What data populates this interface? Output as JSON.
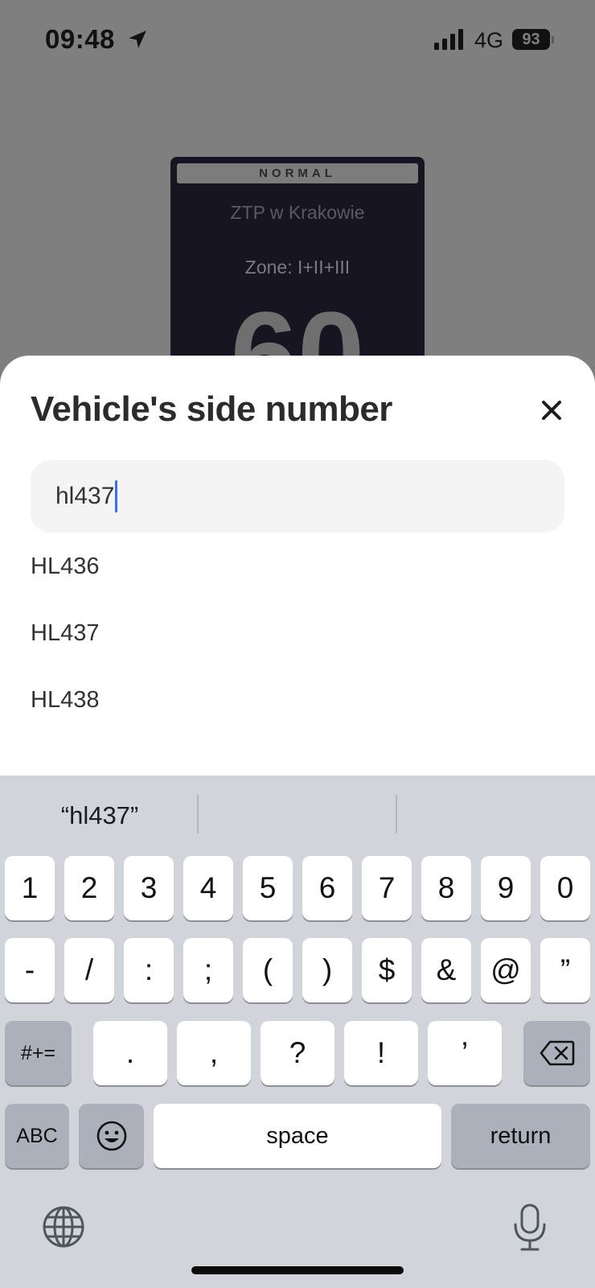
{
  "status_bar": {
    "time": "09:48",
    "location_icon": "location-arrow-icon",
    "signal_icon": "cellular-signal-icon",
    "network": "4G",
    "battery": "93"
  },
  "ticket": {
    "badge": "NORMAL",
    "operator": "ZTP w Krakowie",
    "zone": "Zone: I+II+III",
    "minutes": "60"
  },
  "sheet": {
    "title": "Vehicle's side number",
    "close_icon": "close-icon",
    "input_value": "hl437",
    "suggestions": [
      "HL436",
      "HL437",
      "HL438"
    ]
  },
  "keyboard": {
    "predictions": [
      "“hl437”",
      "",
      ""
    ],
    "row1": [
      "1",
      "2",
      "3",
      "4",
      "5",
      "6",
      "7",
      "8",
      "9",
      "0"
    ],
    "row2": [
      "-",
      "/",
      ":",
      ";",
      "(",
      ")",
      "$",
      "&",
      "@",
      "”"
    ],
    "row3": [
      ".",
      ",",
      "?",
      "!",
      "’"
    ],
    "symbols_key": "#+=",
    "abc_key": "ABC",
    "space_key": "space",
    "return_key": "return",
    "icons": [
      "backspace-icon",
      "emoji-icon",
      "globe-icon",
      "microphone-icon"
    ]
  }
}
